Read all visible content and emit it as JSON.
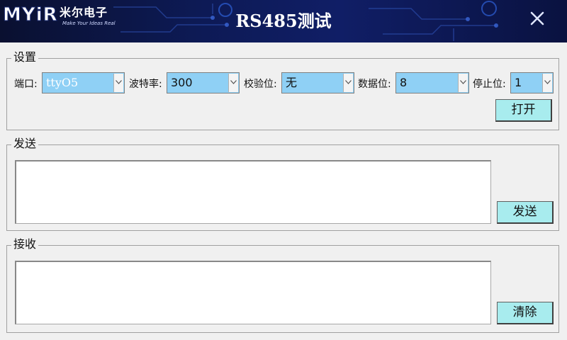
{
  "header": {
    "logo_mark": "MYiR",
    "logo_cn": "米尔电子",
    "logo_slogan": "Make Your Ideas Real",
    "title": "RS485测试"
  },
  "settings": {
    "group_title": "设置",
    "port": {
      "label": "端口:",
      "value": "ttyO5"
    },
    "baud": {
      "label": "波特率:",
      "value": "300"
    },
    "parity": {
      "label": "校验位:",
      "value": "无"
    },
    "databits": {
      "label": "数据位:",
      "value": "8"
    },
    "stopbits": {
      "label": "停止位:",
      "value": "1"
    },
    "open_button": "打开"
  },
  "send": {
    "group_title": "发送",
    "text": "",
    "button": "发送"
  },
  "receive": {
    "group_title": "接收",
    "text": "",
    "button": "清除"
  },
  "colors": {
    "combo_bg": "#8fd0f5",
    "button_bg": "#a8ecee",
    "header_bg": "#0d1a55"
  },
  "icons": [
    "close-icon",
    "chevron-down-icon"
  ]
}
